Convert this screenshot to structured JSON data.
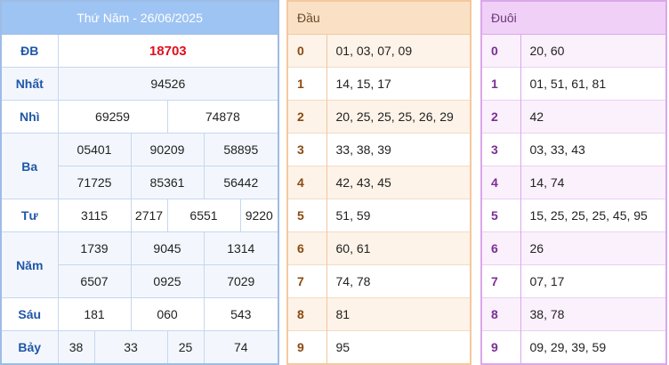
{
  "results": {
    "title": "Thứ Năm - 26/06/2025",
    "special": {
      "label": "ĐB",
      "value": "18703"
    },
    "first": {
      "label": "Nhất",
      "value": "94526"
    },
    "second": {
      "label": "Nhì",
      "values": [
        "69259",
        "74878"
      ]
    },
    "third": {
      "label": "Ba",
      "values": [
        "05401",
        "90209",
        "58895",
        "71725",
        "85361",
        "56442"
      ]
    },
    "fourth": {
      "label": "Tư",
      "values": [
        "3115",
        "2717",
        "6551",
        "9220"
      ]
    },
    "fifth": {
      "label": "Năm",
      "values": [
        "1739",
        "9045",
        "1314",
        "6507",
        "0925",
        "7029"
      ]
    },
    "sixth": {
      "label": "Sáu",
      "values": [
        "181",
        "060",
        "543"
      ]
    },
    "seventh": {
      "label": "Bảy",
      "values": [
        "38",
        "33",
        "25",
        "74"
      ]
    }
  },
  "dau": {
    "header": "Đầu",
    "rows": [
      {
        "key": "0",
        "value": "01, 03, 07, 09"
      },
      {
        "key": "1",
        "value": "14, 15, 17"
      },
      {
        "key": "2",
        "value": "20, 25, 25, 25, 26, 29"
      },
      {
        "key": "3",
        "value": "33, 38, 39"
      },
      {
        "key": "4",
        "value": "42, 43, 45"
      },
      {
        "key": "5",
        "value": "51, 59"
      },
      {
        "key": "6",
        "value": "60, 61"
      },
      {
        "key": "7",
        "value": "74, 78"
      },
      {
        "key": "8",
        "value": "81"
      },
      {
        "key": "9",
        "value": "95"
      }
    ]
  },
  "duoi": {
    "header": "Đuôi",
    "rows": [
      {
        "key": "0",
        "value": "20, 60"
      },
      {
        "key": "1",
        "value": "01, 51, 61, 81"
      },
      {
        "key": "2",
        "value": "42"
      },
      {
        "key": "3",
        "value": "03, 33, 43"
      },
      {
        "key": "4",
        "value": "14, 74"
      },
      {
        "key": "5",
        "value": "15, 25, 25, 25, 45, 95"
      },
      {
        "key": "6",
        "value": "26"
      },
      {
        "key": "7",
        "value": "07, 17"
      },
      {
        "key": "8",
        "value": "38, 78"
      },
      {
        "key": "9",
        "value": "09, 29, 39, 59"
      }
    ]
  }
}
